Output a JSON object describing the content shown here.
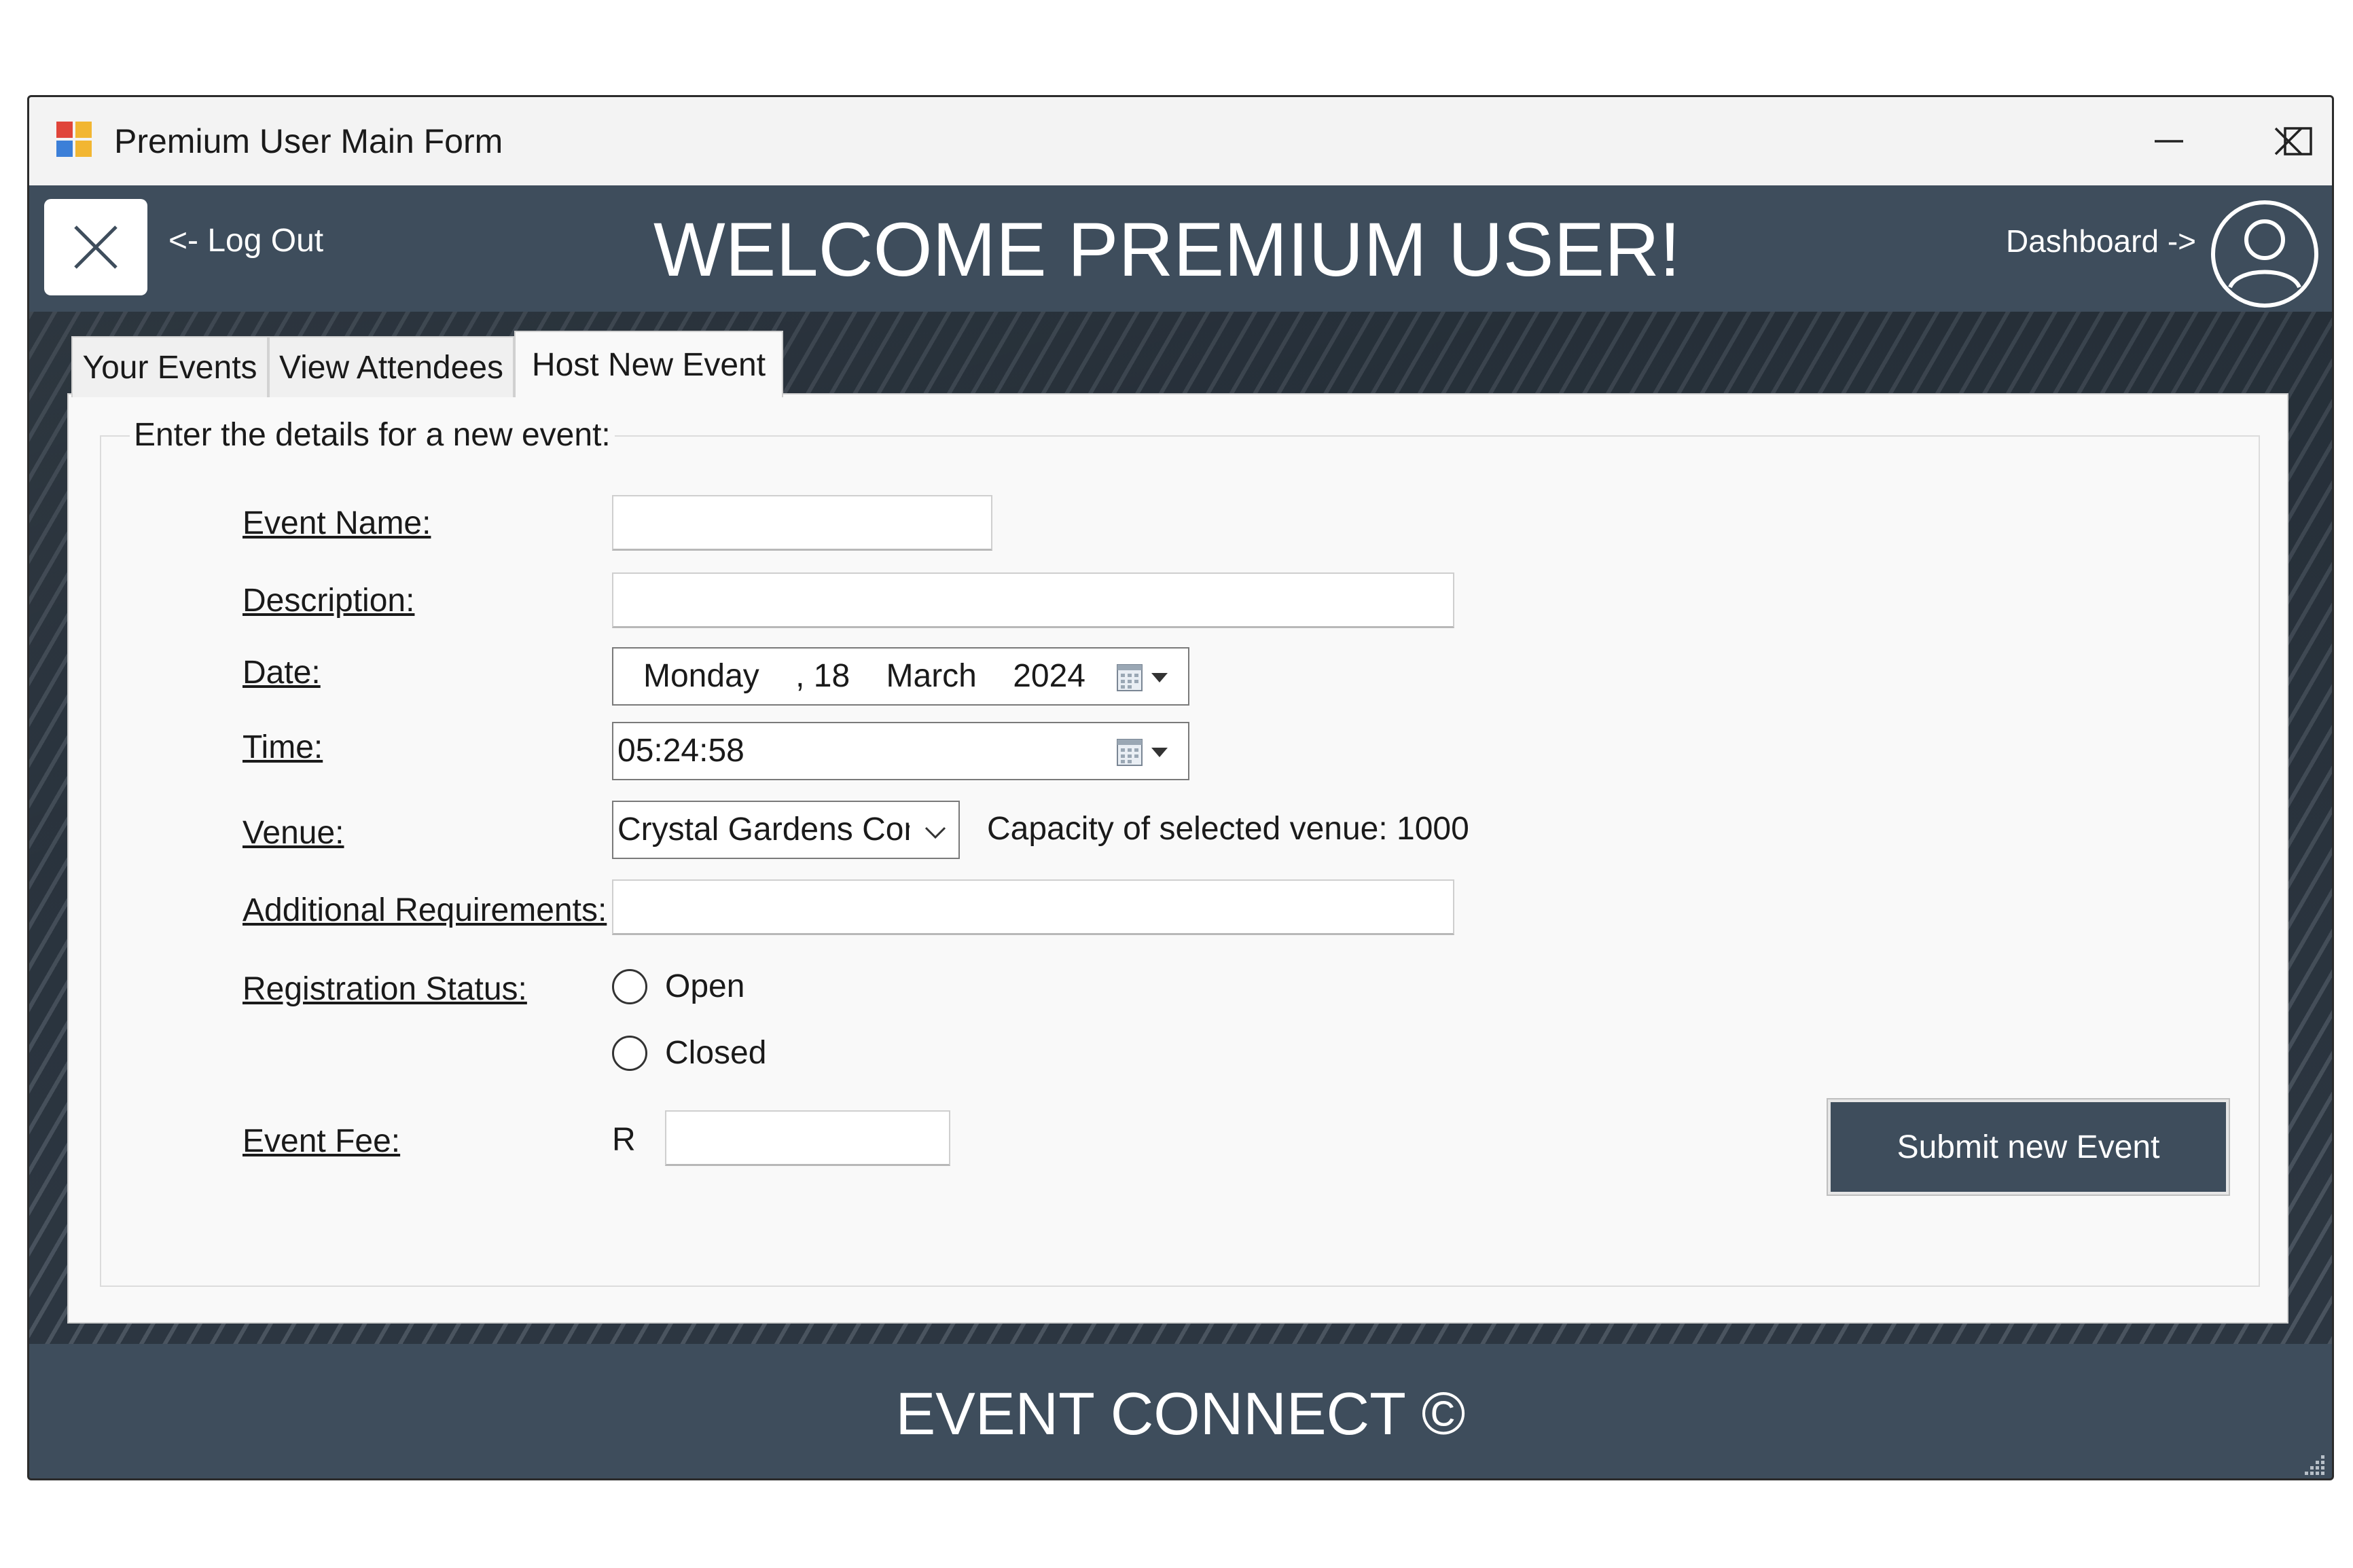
{
  "window": {
    "title": "Premium User Main Form"
  },
  "header": {
    "logout_label": "<- Log Out",
    "welcome_text": "WELCOME PREMIUM USER!",
    "dashboard_label": "Dashboard ->"
  },
  "tabs": [
    {
      "label": "Your Events",
      "active": false
    },
    {
      "label": "View Attendees",
      "active": false
    },
    {
      "label": "Host New Event",
      "active": true
    }
  ],
  "form": {
    "group_title": "Enter the details for a new event:",
    "labels": {
      "event_name": "Event Name:",
      "description": "Description:",
      "date": "Date:",
      "time": "Time:",
      "venue": "Venue:",
      "additional_requirements": "Additional Requirements:",
      "registration_status": "Registration Status:",
      "event_fee": "Event Fee:"
    },
    "values": {
      "event_name": "",
      "description": "",
      "date": "Monday    , 18    March    2024",
      "time": "05:24:58",
      "venue": "Crystal Gardens Conv",
      "additional_requirements": "",
      "event_fee": ""
    },
    "venue_capacity_text": "Capacity of selected venue: 1000",
    "registration_options": [
      "Open",
      "Closed"
    ],
    "currency_symbol": "R",
    "submit_label": "Submit new Event"
  },
  "footer": {
    "text": "EVENT CONNECT ©"
  },
  "colors": {
    "header_bg": "#3e4d5c",
    "panel_bg": "#f9f9f9",
    "titlebar_bg": "#f3f3f3"
  }
}
